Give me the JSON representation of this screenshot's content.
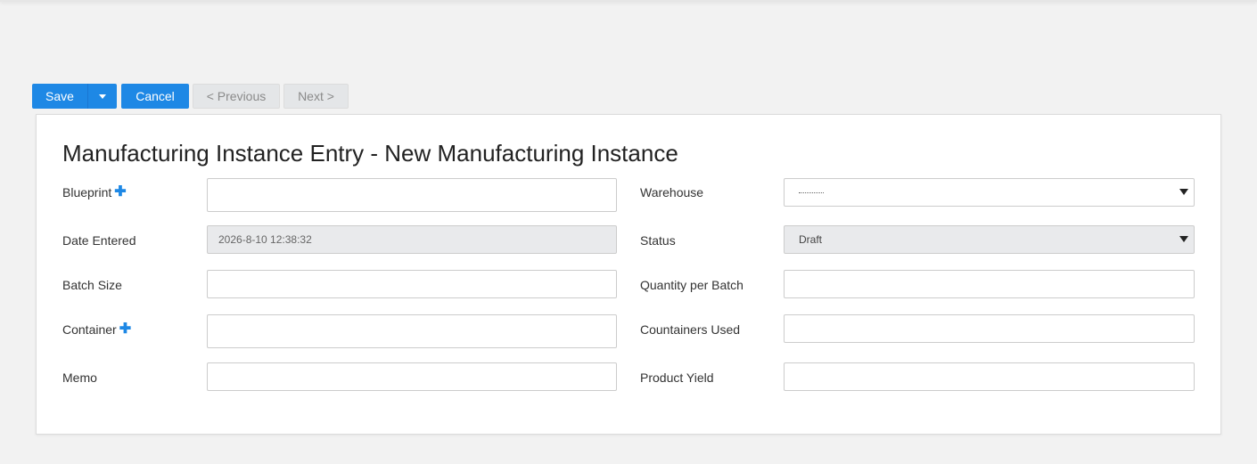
{
  "toolbar": {
    "save_label": "Save",
    "cancel_label": "Cancel",
    "previous_label": "< Previous",
    "next_label": "Next >"
  },
  "form": {
    "title": "Manufacturing Instance Entry - New Manufacturing Instance",
    "fields": {
      "blueprint": {
        "label": "Blueprint",
        "value": ""
      },
      "warehouse": {
        "label": "Warehouse",
        "selected": "---------"
      },
      "date_entered": {
        "label": "Date Entered",
        "value": "2026-8-10 12:38:32"
      },
      "status": {
        "label": "Status",
        "selected": "Draft"
      },
      "batch_size": {
        "label": "Batch Size",
        "value": ""
      },
      "quantity_per_batch": {
        "label": "Quantity per Batch",
        "value": ""
      },
      "container": {
        "label": "Container",
        "value": ""
      },
      "containers_used": {
        "label": "Countainers Used",
        "value": ""
      },
      "memo": {
        "label": "Memo",
        "value": ""
      },
      "product_yield": {
        "label": "Product Yield",
        "value": ""
      }
    }
  },
  "colors": {
    "primary": "#1e88e5",
    "page_background": "#f2f2f2",
    "disabled_button": "#e4e6e8",
    "readonly_field": "#e9eaec"
  },
  "icons": {
    "add": "plus-icon",
    "dropdown": "caret-down-icon"
  }
}
